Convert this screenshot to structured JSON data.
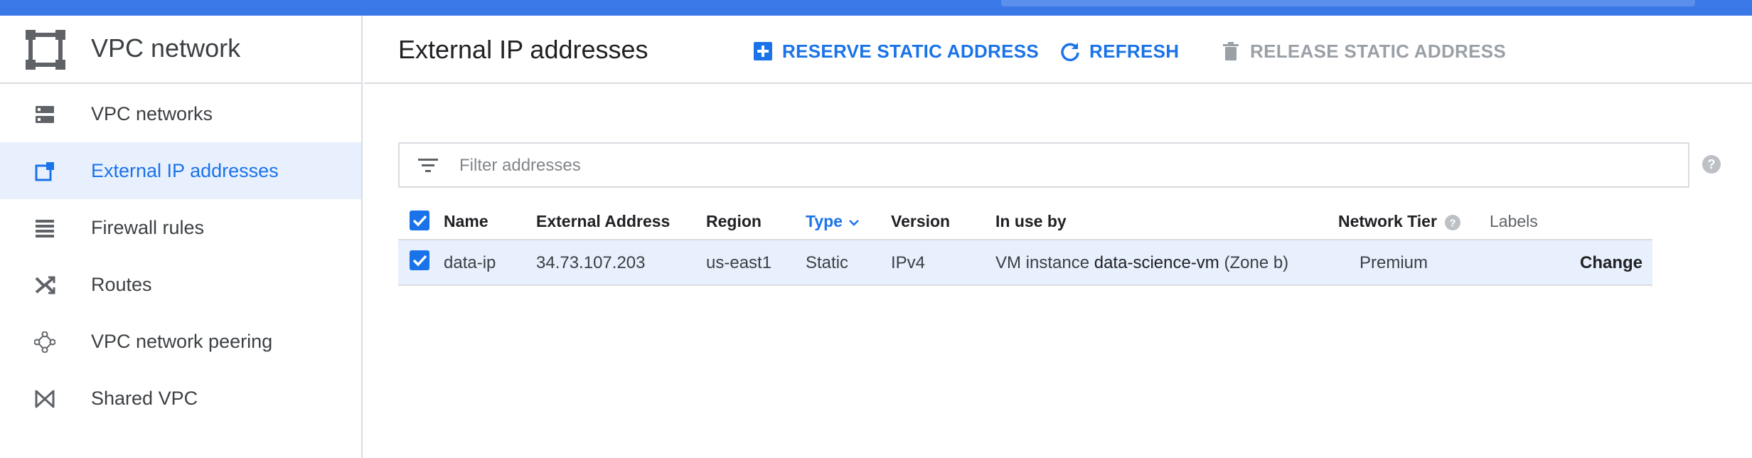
{
  "sidebar": {
    "product_title": "VPC network",
    "product_icon": "vpc-network-icon",
    "items": [
      {
        "label": "VPC networks",
        "icon": "vpc-networks-icon",
        "active": false
      },
      {
        "label": "External IP addresses",
        "icon": "external-ip-icon",
        "active": true
      },
      {
        "label": "Firewall rules",
        "icon": "firewall-icon",
        "active": false
      },
      {
        "label": "Routes",
        "icon": "routes-icon",
        "active": false
      },
      {
        "label": "VPC network peering",
        "icon": "peering-icon",
        "active": false
      },
      {
        "label": "Shared VPC",
        "icon": "shared-vpc-icon",
        "active": false
      }
    ]
  },
  "header": {
    "title": "External IP addresses",
    "actions": {
      "reserve": "RESERVE STATIC ADDRESS",
      "refresh": "REFRESH",
      "release": "RELEASE STATIC ADDRESS"
    }
  },
  "filter": {
    "placeholder": "Filter addresses",
    "value": ""
  },
  "table": {
    "columns": [
      "Name",
      "External Address",
      "Region",
      "Type",
      "Version",
      "In use by",
      "Network Tier",
      "Labels"
    ],
    "sorted_column": "Type",
    "rows": [
      {
        "selected": true,
        "name": "data-ip",
        "external_address": "34.73.107.203",
        "region": "us-east1",
        "type": "Static",
        "version": "IPv4",
        "in_use_prefix": "VM instance",
        "in_use_vm": "data-science-vm",
        "in_use_suffix": "(Zone b)",
        "network_tier": "Premium",
        "action": "Change"
      }
    ]
  },
  "colors": {
    "accent": "#1a73e8",
    "topbar": "#3b78e7",
    "selected_row": "#e8f0fe",
    "disabled": "#9aa0a6"
  }
}
